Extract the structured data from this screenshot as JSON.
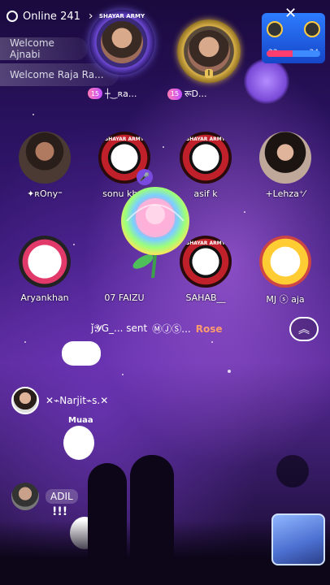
{
  "header": {
    "online_label": "Online 241",
    "chevron": "›"
  },
  "welcome": [
    {
      "text": "Welcome Ajnabi"
    },
    {
      "text": "Welcome Raja Ra..."
    }
  ],
  "hosts": [
    {
      "name": "┼‿ʀа...",
      "badge": "15",
      "frame_text": "SHAYAR ARMY"
    },
    {
      "name": "रूD...",
      "badge": "15",
      "rank": "I"
    }
  ],
  "pk": {
    "score_left": "33",
    "score_right": "34",
    "progress_left": 0.49
  },
  "seats_row1": [
    {
      "name": "✦ʀOny⁼",
      "type": "photo"
    },
    {
      "name": "sonu kh...",
      "type": "badge",
      "frame_text": "SHAYAR ARMY"
    },
    {
      "name": "asif k",
      "type": "badge",
      "frame_text": "SHAYAR ARMY"
    },
    {
      "name": "+Lehza⁺⁄",
      "type": "girl"
    }
  ],
  "seats_row2": [
    {
      "name": "Aryankhan",
      "type": "cartoon"
    },
    {
      "name": "07 FAIZU",
      "type": "rose"
    },
    {
      "name": "SAHAB__",
      "type": "badge",
      "frame_text": "SHAYAR ARMY"
    },
    {
      "name": "MJ ⓢ aja",
      "type": "cartoon2"
    }
  ],
  "gift_message": {
    "sender": "ǰ𝓨G_... sent",
    "recipient": "ⓂⒿⓈ...",
    "gift": "Rose"
  },
  "chat": [
    {
      "user": "✕⌁Narjit⌁s.✕"
    },
    {
      "user": "ADIL"
    }
  ],
  "stickers": {
    "muah": "Muaa",
    "exclaim": "!!!"
  },
  "colors": {
    "accent_purple": "#7a4ae0",
    "gift_orange": "#ff9c6e",
    "pk_blue": "#2d7cff",
    "pk_red": "#ff3d6e"
  }
}
